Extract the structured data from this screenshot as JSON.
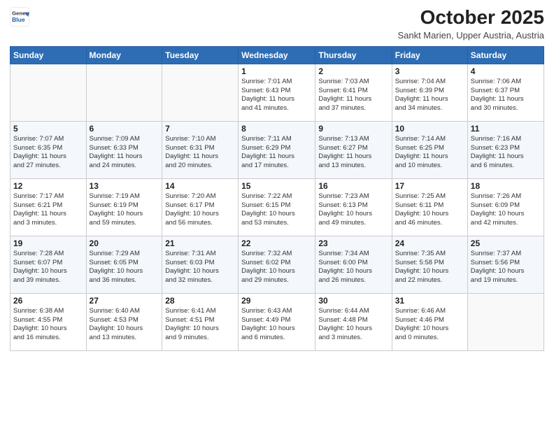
{
  "header": {
    "logo_line1": "General",
    "logo_line2": "Blue",
    "month": "October 2025",
    "location": "Sankt Marien, Upper Austria, Austria"
  },
  "weekdays": [
    "Sunday",
    "Monday",
    "Tuesday",
    "Wednesday",
    "Thursday",
    "Friday",
    "Saturday"
  ],
  "weeks": [
    [
      {
        "day": "",
        "info": ""
      },
      {
        "day": "",
        "info": ""
      },
      {
        "day": "",
        "info": ""
      },
      {
        "day": "1",
        "info": "Sunrise: 7:01 AM\nSunset: 6:43 PM\nDaylight: 11 hours\nand 41 minutes."
      },
      {
        "day": "2",
        "info": "Sunrise: 7:03 AM\nSunset: 6:41 PM\nDaylight: 11 hours\nand 37 minutes."
      },
      {
        "day": "3",
        "info": "Sunrise: 7:04 AM\nSunset: 6:39 PM\nDaylight: 11 hours\nand 34 minutes."
      },
      {
        "day": "4",
        "info": "Sunrise: 7:06 AM\nSunset: 6:37 PM\nDaylight: 11 hours\nand 30 minutes."
      }
    ],
    [
      {
        "day": "5",
        "info": "Sunrise: 7:07 AM\nSunset: 6:35 PM\nDaylight: 11 hours\nand 27 minutes."
      },
      {
        "day": "6",
        "info": "Sunrise: 7:09 AM\nSunset: 6:33 PM\nDaylight: 11 hours\nand 24 minutes."
      },
      {
        "day": "7",
        "info": "Sunrise: 7:10 AM\nSunset: 6:31 PM\nDaylight: 11 hours\nand 20 minutes."
      },
      {
        "day": "8",
        "info": "Sunrise: 7:11 AM\nSunset: 6:29 PM\nDaylight: 11 hours\nand 17 minutes."
      },
      {
        "day": "9",
        "info": "Sunrise: 7:13 AM\nSunset: 6:27 PM\nDaylight: 11 hours\nand 13 minutes."
      },
      {
        "day": "10",
        "info": "Sunrise: 7:14 AM\nSunset: 6:25 PM\nDaylight: 11 hours\nand 10 minutes."
      },
      {
        "day": "11",
        "info": "Sunrise: 7:16 AM\nSunset: 6:23 PM\nDaylight: 11 hours\nand 6 minutes."
      }
    ],
    [
      {
        "day": "12",
        "info": "Sunrise: 7:17 AM\nSunset: 6:21 PM\nDaylight: 11 hours\nand 3 minutes."
      },
      {
        "day": "13",
        "info": "Sunrise: 7:19 AM\nSunset: 6:19 PM\nDaylight: 10 hours\nand 59 minutes."
      },
      {
        "day": "14",
        "info": "Sunrise: 7:20 AM\nSunset: 6:17 PM\nDaylight: 10 hours\nand 56 minutes."
      },
      {
        "day": "15",
        "info": "Sunrise: 7:22 AM\nSunset: 6:15 PM\nDaylight: 10 hours\nand 53 minutes."
      },
      {
        "day": "16",
        "info": "Sunrise: 7:23 AM\nSunset: 6:13 PM\nDaylight: 10 hours\nand 49 minutes."
      },
      {
        "day": "17",
        "info": "Sunrise: 7:25 AM\nSunset: 6:11 PM\nDaylight: 10 hours\nand 46 minutes."
      },
      {
        "day": "18",
        "info": "Sunrise: 7:26 AM\nSunset: 6:09 PM\nDaylight: 10 hours\nand 42 minutes."
      }
    ],
    [
      {
        "day": "19",
        "info": "Sunrise: 7:28 AM\nSunset: 6:07 PM\nDaylight: 10 hours\nand 39 minutes."
      },
      {
        "day": "20",
        "info": "Sunrise: 7:29 AM\nSunset: 6:05 PM\nDaylight: 10 hours\nand 36 minutes."
      },
      {
        "day": "21",
        "info": "Sunrise: 7:31 AM\nSunset: 6:03 PM\nDaylight: 10 hours\nand 32 minutes."
      },
      {
        "day": "22",
        "info": "Sunrise: 7:32 AM\nSunset: 6:02 PM\nDaylight: 10 hours\nand 29 minutes."
      },
      {
        "day": "23",
        "info": "Sunrise: 7:34 AM\nSunset: 6:00 PM\nDaylight: 10 hours\nand 26 minutes."
      },
      {
        "day": "24",
        "info": "Sunrise: 7:35 AM\nSunset: 5:58 PM\nDaylight: 10 hours\nand 22 minutes."
      },
      {
        "day": "25",
        "info": "Sunrise: 7:37 AM\nSunset: 5:56 PM\nDaylight: 10 hours\nand 19 minutes."
      }
    ],
    [
      {
        "day": "26",
        "info": "Sunrise: 6:38 AM\nSunset: 4:55 PM\nDaylight: 10 hours\nand 16 minutes."
      },
      {
        "day": "27",
        "info": "Sunrise: 6:40 AM\nSunset: 4:53 PM\nDaylight: 10 hours\nand 13 minutes."
      },
      {
        "day": "28",
        "info": "Sunrise: 6:41 AM\nSunset: 4:51 PM\nDaylight: 10 hours\nand 9 minutes."
      },
      {
        "day": "29",
        "info": "Sunrise: 6:43 AM\nSunset: 4:49 PM\nDaylight: 10 hours\nand 6 minutes."
      },
      {
        "day": "30",
        "info": "Sunrise: 6:44 AM\nSunset: 4:48 PM\nDaylight: 10 hours\nand 3 minutes."
      },
      {
        "day": "31",
        "info": "Sunrise: 6:46 AM\nSunset: 4:46 PM\nDaylight: 10 hours\nand 0 minutes."
      },
      {
        "day": "",
        "info": ""
      }
    ]
  ]
}
